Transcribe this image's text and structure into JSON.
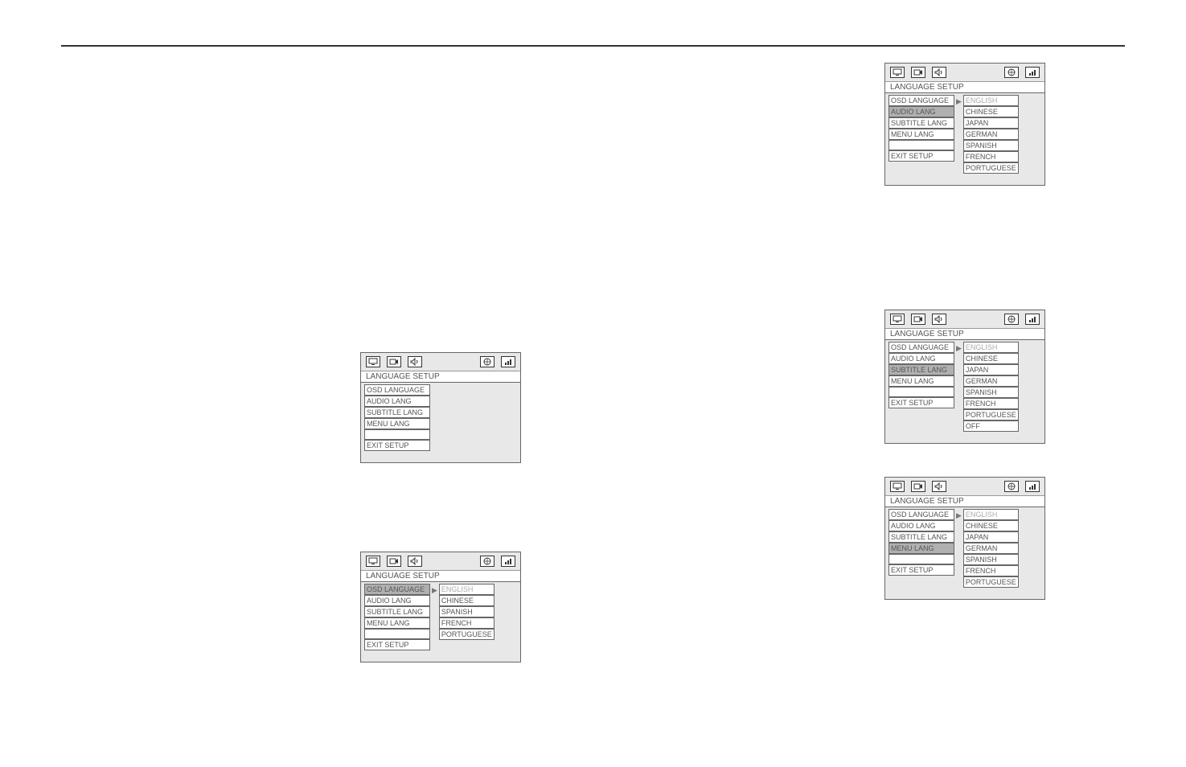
{
  "title": "LANGUAGE SETUP",
  "menuItems": [
    "OSD LANGUAGE",
    "AUDIO LANG",
    "SUBTITLE LANG",
    "MENU LANG",
    "",
    "EXIT SETUP"
  ],
  "langs5": [
    "ENGLISH",
    "CHINESE",
    "SPANISH",
    "FRENCH",
    "PORTUGUESE"
  ],
  "langs7": [
    "ENGLISH",
    "CHINESE",
    "JAPAN",
    "GERMAN",
    "SPANISH",
    "FRENCH",
    "PORTUGUESE"
  ],
  "langs8": [
    "ENGLISH",
    "CHINESE",
    "JAPAN",
    "GERMAN",
    "SPANISH",
    "FRENCH",
    "PORTUGUESE",
    "OFF"
  ],
  "panel1": {
    "highlight": null,
    "opts": null,
    "arrowRow": null
  },
  "panel2": {
    "highlight": 0,
    "opts": "langs5",
    "arrowRow": 0
  },
  "panel3": {
    "highlight": 1,
    "opts": "langs7",
    "arrowRow": 0
  },
  "panel4": {
    "highlight": 2,
    "opts": "langs8",
    "arrowRow": 0
  },
  "panel5": {
    "highlight": 3,
    "opts": "langs7",
    "arrowRow": 0
  }
}
